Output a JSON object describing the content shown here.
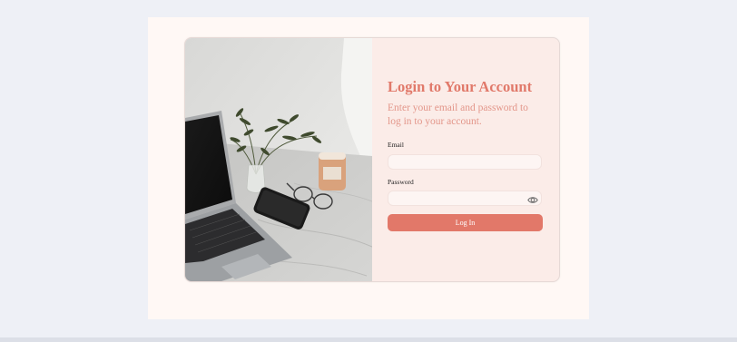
{
  "login": {
    "title": "Login to Your Account",
    "subtitle": "Enter your email and password to log in to your account.",
    "email_label": "Email",
    "email_value": "",
    "password_label": "Password",
    "password_value": "",
    "show_password_icon": "eye-icon",
    "submit_label": "Log In"
  },
  "image": {
    "subject": "laptop-phone-plant-candle-glasses-on-table"
  },
  "colors": {
    "background": "#eef0f6",
    "page": "#fff8f5",
    "card": "#fbece8",
    "accent": "#e27869",
    "title": "#e1796a",
    "subtitle": "#e3968a"
  }
}
